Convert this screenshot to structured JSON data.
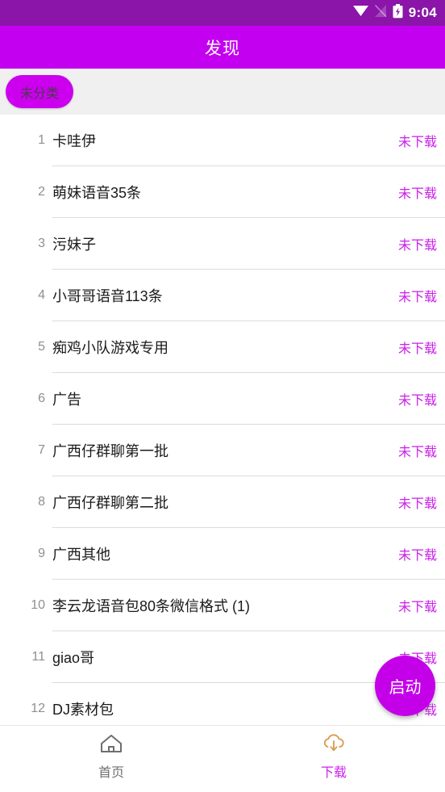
{
  "status_bar": {
    "time": "9:04",
    "icons": [
      "wifi-icon",
      "no-signal-icon",
      "battery-charging-icon"
    ],
    "background_color": "#8a15a8"
  },
  "app_bar": {
    "title": "发现",
    "background_color": "#c400f0",
    "title_color": "#ffffff"
  },
  "chip_bar": {
    "background_color": "#f0f0f0",
    "chips": [
      {
        "label": "未分类",
        "selected": true,
        "color": "#cc00ee"
      }
    ]
  },
  "list": {
    "status_label": "未下载",
    "status_color": "#c920e8",
    "rows": [
      {
        "index": "1",
        "title": "卡哇伊",
        "status": "未下载"
      },
      {
        "index": "2",
        "title": "萌妹语音35条",
        "status": "未下载"
      },
      {
        "index": "3",
        "title": "污妹子",
        "status": "未下载"
      },
      {
        "index": "4",
        "title": "小哥哥语音113条",
        "status": "未下载"
      },
      {
        "index": "5",
        "title": "痴鸡小队游戏专用",
        "status": "未下载"
      },
      {
        "index": "6",
        "title": "广告",
        "status": "未下载"
      },
      {
        "index": "7",
        "title": "广西仔群聊第一批",
        "status": "未下载"
      },
      {
        "index": "8",
        "title": "广西仔群聊第二批",
        "status": "未下载"
      },
      {
        "index": "9",
        "title": "广西其他",
        "status": "未下载"
      },
      {
        "index": "10",
        "title": "李云龙语音包80条微信格式 (1)",
        "status": "未下载"
      },
      {
        "index": "11",
        "title": "giao哥",
        "status": "未下载"
      },
      {
        "index": "12",
        "title": "DJ素材包",
        "status": "未下载"
      }
    ]
  },
  "fab": {
    "label": "启动",
    "color": "#c400e8",
    "text_color": "#ffffff"
  },
  "bottom_nav": {
    "items": [
      {
        "label": "首页",
        "icon": "home-icon",
        "active": false,
        "color": "#707070"
      },
      {
        "label": "下载",
        "icon": "cloud-download-icon",
        "active": true,
        "color": "#cc22ee",
        "icon_color": "#d79a4e"
      }
    ]
  }
}
